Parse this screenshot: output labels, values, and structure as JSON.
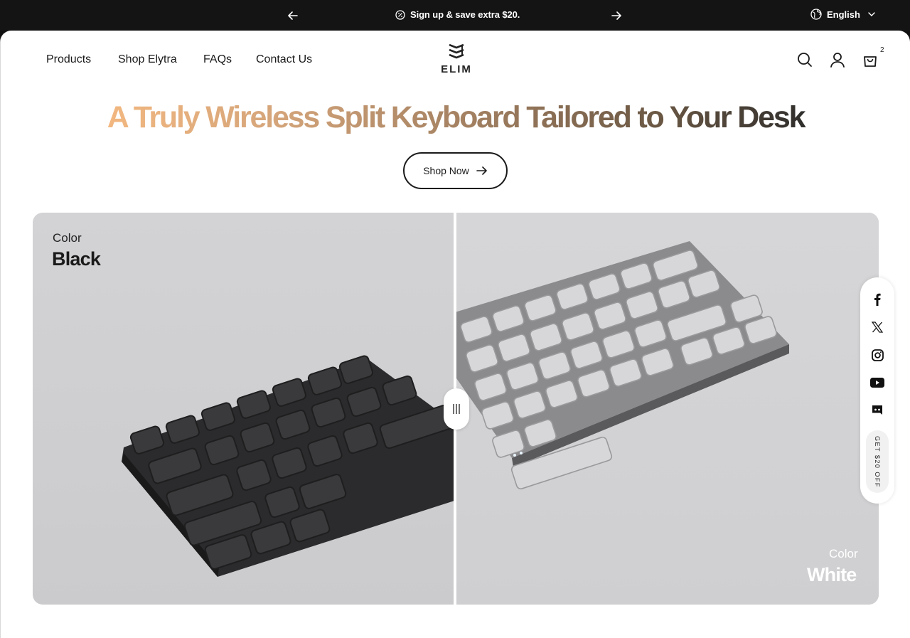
{
  "announcement": {
    "text": "Sign up & save extra $20.",
    "prev_icon": "arrow-left-icon",
    "next_icon": "arrow-right-icon"
  },
  "language": {
    "label": "English",
    "icon": "globe-icon"
  },
  "nav": {
    "items": [
      "Products",
      "Shop Elytra",
      "FAQs",
      "Contact Us"
    ]
  },
  "logo": {
    "text": "ELIM"
  },
  "header_icons": [
    "search-icon",
    "account-icon",
    "cart-icon"
  ],
  "cart": {
    "count": "2"
  },
  "hero": {
    "headline": "A Truly Wireless Split Keyboard Tailored to Your Desk",
    "cta_label": "Shop Now"
  },
  "compare": {
    "left": {
      "label": "Color",
      "name": "Black"
    },
    "right": {
      "label": "Color",
      "name": "White"
    }
  },
  "social": {
    "icons": [
      "facebook-icon",
      "x-icon",
      "instagram-icon",
      "youtube-icon",
      "discord-icon"
    ],
    "promo": "GET $20 OFF"
  },
  "colors": {
    "topbar": "#141414",
    "headline_start": "#f2b780",
    "headline_end": "#2a2a2a",
    "panel_bg": "#d0d0d2"
  }
}
